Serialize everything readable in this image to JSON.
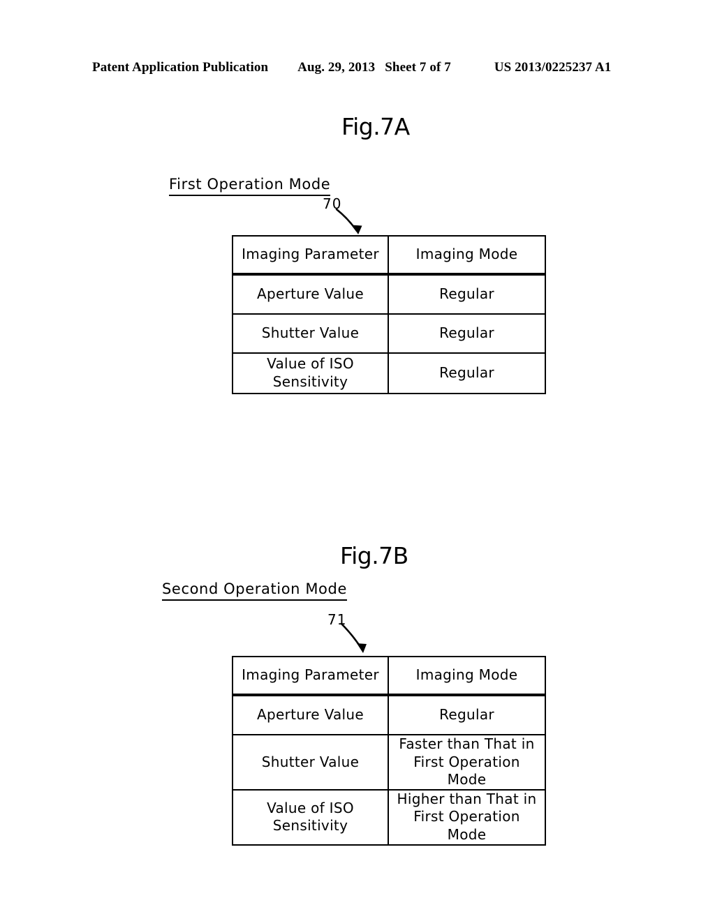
{
  "header": {
    "publication": "Patent Application Publication",
    "date": "Aug. 29, 2013",
    "sheet": "Sheet 7 of 7",
    "patent_number": "US 2013/0225237 A1"
  },
  "figures": [
    {
      "title": "Fig.7A",
      "mode_label": "First Operation Mode",
      "reference_numeral": "70",
      "table": {
        "columns": [
          "Imaging Parameter",
          "Imaging Mode"
        ],
        "rows": [
          {
            "parameter": [
              "Aperture Value"
            ],
            "mode": [
              "Regular"
            ]
          },
          {
            "parameter": [
              "Shutter Value"
            ],
            "mode": [
              "Regular"
            ]
          },
          {
            "parameter": [
              "Value of ISO",
              "Sensitivity"
            ],
            "mode": [
              "Regular"
            ]
          }
        ]
      }
    },
    {
      "title": "Fig.7B",
      "mode_label": "Second Operation Mode",
      "reference_numeral": "71",
      "table": {
        "columns": [
          "Imaging Parameter",
          "Imaging Mode"
        ],
        "rows": [
          {
            "parameter": [
              "Aperture Value"
            ],
            "mode": [
              "Regular"
            ]
          },
          {
            "parameter": [
              "Shutter Value"
            ],
            "mode": [
              "Faster than That in",
              "First Operation Mode"
            ]
          },
          {
            "parameter": [
              "Value of ISO",
              "Sensitivity"
            ],
            "mode": [
              "Higher than That in",
              "First Operation Mode"
            ]
          }
        ]
      }
    }
  ],
  "colors": {
    "ink": "#000000",
    "paper": "#ffffff"
  }
}
